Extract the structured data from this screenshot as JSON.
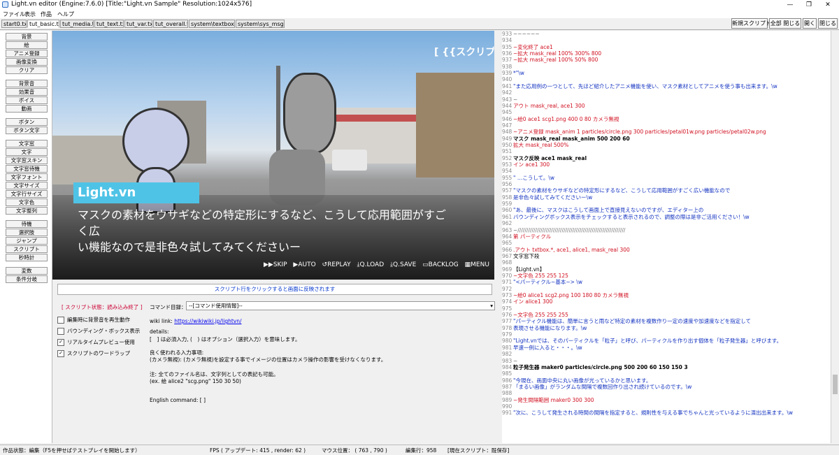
{
  "window": {
    "title": "Light.vn editor (Engine:7.6.0) [Title:\"Light.vn Sample\" Resolution:1024x576]",
    "controls": [
      "—",
      "❐",
      "✕"
    ]
  },
  "menu": [
    "ファイル",
    "表示",
    "作品",
    "ヘルプ"
  ],
  "tabs": [
    {
      "label": "start0.txt",
      "active": false
    },
    {
      "label": "tut_basic.txt",
      "active": true
    },
    {
      "label": "tut_media.txt",
      "active": false
    },
    {
      "label": "tut_text.txt",
      "active": false
    },
    {
      "label": "tut_var.txt",
      "active": false
    },
    {
      "label": "tut_overall.txt",
      "active": false
    },
    {
      "label": "system\\textbox.txt",
      "active": false
    },
    {
      "label": "system\\sys_msg.txt",
      "active": false
    }
  ],
  "toolbar": {
    "new_script": "新規スクリプト",
    "close_all": "全部 閉じる",
    "open": "開く",
    "close": "閉じる"
  },
  "left_buttons": [
    "背景",
    "絵",
    "アニメ登録",
    "画像変換",
    "クリア",
    "背景音",
    "効果音",
    "ボイス",
    "動画",
    "ボタン",
    "ボタン文字",
    "文字窓",
    "文字",
    "文字窓スキン",
    "文字窓待機",
    "文字フォント",
    "文字サイズ",
    "文字行サイズ",
    "文字色",
    "文字整列",
    "待機",
    "選択肢",
    "ジャンプ",
    "スクリプト",
    "秒時計",
    "変数",
    "条件分岐"
  ],
  "scene": {
    "name": "Light.vn",
    "message_line1": "マスクの素材をウサギなどの特定形にするなど、こうして応用範囲がすごく広",
    "message_line2": "い機能なので是非色々試してみてくださいー",
    "script_hint": "[ {{スクリプト",
    "controls": [
      "▶▶SKIP",
      "▶AUTO",
      "↺REPLAY",
      "⤓Q.LOAD",
      "⤓Q.SAVE",
      "▭BACKLOG",
      "▦MENU"
    ]
  },
  "hint_bar": "スクリプト行をクリックすると画面に反映されます",
  "script_status": "[ スクリプト状態：読み込み終了 ]",
  "checkboxes": [
    {
      "label": "編集時に背景音を再生動作",
      "checked": false
    },
    {
      "label": "バウンディング・ボックス表示",
      "checked": false
    },
    {
      "label": "リアルタイムプレビュー使用",
      "checked": true
    },
    {
      "label": "スクリプトのワードラップ",
      "checked": true
    }
  ],
  "command_catalog": {
    "label": "コマンド目録：",
    "selected": "--[コマンド使用情報]--"
  },
  "help": {
    "wiki_label": "wiki link:",
    "wiki_url": "https://wikiwiki.jp/lightvn/",
    "details": "details:",
    "line1": "[　] は必須入力, (　) はオプション（選択入力）を意味します。",
    "line2": "良く使われる入力事項:",
    "line3": "(カメラ無視): (カメラ無視)を設定する事でイメージの位置はカメラ操作の影響を受けなくなります。",
    "line4": "注: 全てのファイル名は、文字列としての表記も可能。",
    "line5": "(ex. 絵 alice2 \"scg.png\" 150 30 50)",
    "english": "English command: [  ]"
  },
  "editor_lines": [
    {
      "n": "933",
      "t": "~~~~~~",
      "c": "gray"
    },
    {
      "n": "934",
      "t": "",
      "c": ""
    },
    {
      "n": "935",
      "t": "~変化終了 ace1",
      "c": "red"
    },
    {
      "n": "936",
      "t": "~拡大 mask_real 100% 300% 800",
      "c": "red"
    },
    {
      "n": "937",
      "t": "~拡大 mask_real 100% 50% 800",
      "c": "red"
    },
    {
      "n": "938",
      "t": "",
      "c": ""
    },
    {
      "n": "939",
      "t": "*\"\\w",
      "c": "blue"
    },
    {
      "n": "940",
      "t": "",
      "c": ""
    },
    {
      "n": "941",
      "t": "\"また応用例の一つとして、先ほど紹介したアニメ機能を使い、マスク素材としてアニメを使う事も出来ます。\\w",
      "c": "blue"
    },
    {
      "n": "942",
      "t": "",
      "c": ""
    },
    {
      "n": "943",
      "t": "~",
      "c": "gray"
    },
    {
      "n": "944",
      "t": "アウト mask_real, ace1 300",
      "c": "red"
    },
    {
      "n": "945",
      "t": "",
      "c": ""
    },
    {
      "n": "946",
      "t": "~絵0 ace1 scg1.png 400 0 80 カメラ無視",
      "c": "red"
    },
    {
      "n": "947",
      "t": "",
      "c": ""
    },
    {
      "n": "948",
      "t": "~アニメ登録 mask_anim 1 particles/circle.png 300 particles/petal01w.png particles/petal02w.png",
      "c": "red"
    },
    {
      "n": "949",
      "t": "マスク mask_real mask_anim 500 200 60",
      "c": "bold"
    },
    {
      "n": "950",
      "t": "拡大 mask_real 500%",
      "c": "red"
    },
    {
      "n": "951",
      "t": "",
      "c": ""
    },
    {
      "n": "952",
      "t": "マスク反映 ace1 mask_real",
      "c": "bold"
    },
    {
      "n": "953",
      "t": "イン ace1 300",
      "c": "red"
    },
    {
      "n": "954",
      "t": "",
      "c": ""
    },
    {
      "n": "955",
      "t": "\" …こうして。\\w",
      "c": "blue"
    },
    {
      "n": "956",
      "t": "",
      "c": ""
    },
    {
      "n": "957",
      "t": "\"マスクの素材をウサギなどの特定形にするなど、こうして応用範囲がすごく広い機能なので",
      "c": "blue"
    },
    {
      "n": "958",
      "t": "是非色々試してみてくださいー\\w",
      "c": "blue"
    },
    {
      "n": "959",
      "t": "",
      "c": ""
    },
    {
      "n": "960",
      "t": "\"あ、最後に、マスクはこうして画面上で直接見えないのですが、エディター上の",
      "c": "blue"
    },
    {
      "n": "961",
      "t": "バウンディングボックス表示をチェックすると表示されるので、調整の際は是非ご活用ください！\\w",
      "c": "blue"
    },
    {
      "n": "962",
      "t": "",
      "c": ""
    },
    {
      "n": "963",
      "t": "~/////////////////////////////////////////////////////////////",
      "c": "gray"
    },
    {
      "n": "964",
      "t": "第 パーティクル",
      "c": "red"
    },
    {
      "n": "965",
      "t": "",
      "c": ""
    },
    {
      "n": "966",
      "t": ".アウト txtbox.*, ace1, alice1, mask_real 300",
      "c": "red"
    },
    {
      "n": "967",
      "t": "文字窓下段",
      "c": ""
    },
    {
      "n": "968",
      "t": "",
      "c": ""
    },
    {
      "n": "969",
      "t": "【Light.vn】",
      "c": ""
    },
    {
      "n": "970",
      "t": "~文字色 255 255 125",
      "c": "red"
    },
    {
      "n": "971",
      "t": "\"<パーティクル~基本~> \\w",
      "c": "blue"
    },
    {
      "n": "972",
      "t": "",
      "c": ""
    },
    {
      "n": "973",
      "t": "~絵0 alice1 scg2.png 100 180 80 カメラ無視",
      "c": "red"
    },
    {
      "n": "974",
      "t": "イン alice1 300",
      "c": "red"
    },
    {
      "n": "975",
      "t": "",
      "c": ""
    },
    {
      "n": "976",
      "t": "~文字色 255 255 255",
      "c": "red"
    },
    {
      "n": "977",
      "t": "\"パーティクル機能は、簡単に言うと雨など特定の素材を複数作り一定の速度や加速度などを指定して",
      "c": "blue"
    },
    {
      "n": "978",
      "t": "表現させる機能になります。\\w",
      "c": "blue"
    },
    {
      "n": "979",
      "t": "",
      "c": ""
    },
    {
      "n": "980",
      "t": "\"Light.vnでは、そのパーティクルを「粒子」と呼び、パーティクルを作り出す個体を「粒子発生器」と呼びます。",
      "c": "blue"
    },
    {
      "n": "981",
      "t": "早速一例に入ると・・・。\\w",
      "c": "blue"
    },
    {
      "n": "982",
      "t": "",
      "c": ""
    },
    {
      "n": "983",
      "t": "~",
      "c": "gray"
    },
    {
      "n": "984",
      "t": "粒子発生器 maker0 particles/circle.png 500 200 60 150 150 3",
      "c": "bold"
    },
    {
      "n": "985",
      "t": "",
      "c": ""
    },
    {
      "n": "986",
      "t": "\"今現在、画面中央に丸い画像が光っているかと思います。",
      "c": "blue"
    },
    {
      "n": "987",
      "t": "「まるい画像」がランダムな間隔で複数回作り出され続けているのです。\\w",
      "c": "blue"
    },
    {
      "n": "988",
      "t": "",
      "c": ""
    },
    {
      "n": "989",
      "t": "~発生間隔範囲 maker0 300 300",
      "c": "red"
    },
    {
      "n": "990",
      "t": "",
      "c": ""
    },
    {
      "n": "991",
      "t": "\"次に、こうして発生される時間の間隔を指定すると、規則性を与える事でちゃんと光っているように演出出来ます。\\w",
      "c": "blue"
    }
  ],
  "statusbar": {
    "mode": "作品状態：編集（F5を押せばテストプレイを開始します）",
    "fps": "FPS ( アップデート: 415 , render: 62 )",
    "mouse": "マウス位置： ( 763 , 790 )",
    "line": "編集行：958",
    "current": "[現在スクリプト：既保存]"
  }
}
